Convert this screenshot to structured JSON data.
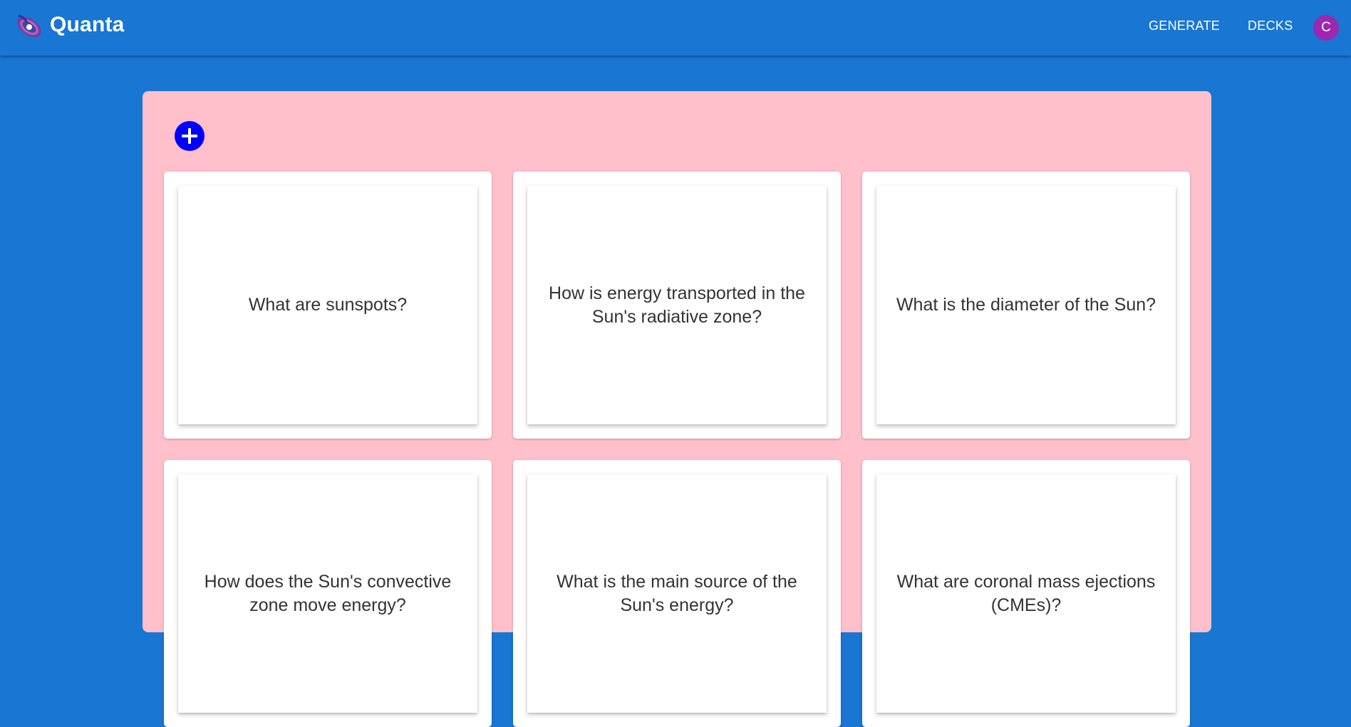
{
  "app": {
    "brand": "Quanta",
    "logo_icon": "galaxy-logo-icon"
  },
  "nav": {
    "generate": "GENERATE",
    "decks": "DECKS",
    "avatar_initial": "C"
  },
  "deck": {
    "add_icon": "plus-circle-icon",
    "cards": [
      {
        "question": "What are sunspots?"
      },
      {
        "question": "How is energy transported in the Sun's radiative zone?"
      },
      {
        "question": "What is the diameter of the Sun?"
      },
      {
        "question": "How does the Sun's convective zone move energy?"
      },
      {
        "question": "What is the main source of the Sun's energy?"
      },
      {
        "question": "What are coronal mass ejections (CMEs)?"
      }
    ]
  },
  "colors": {
    "appbar": "#1976d2",
    "panel": "#ffc0cb",
    "add_button": "#0000ff",
    "avatar": "#9c27b0"
  }
}
